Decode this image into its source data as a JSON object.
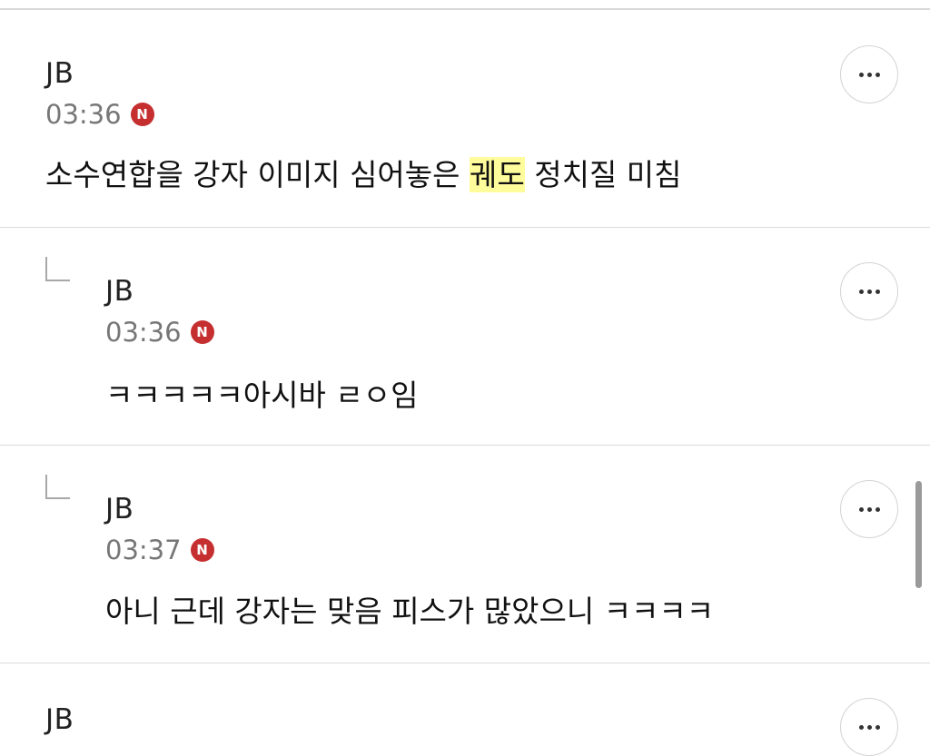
{
  "comments": [
    {
      "author": "JB",
      "time": "03:36",
      "badge": "N",
      "text_before": "소수연합을 강자 이미지 심어놓은 ",
      "text_highlight": "궤도",
      "text_after": " 정치질 미침",
      "reply": false
    },
    {
      "author": "JB",
      "time": "03:36",
      "badge": "N",
      "text": "ㅋㅋㅋㅋㅋ아시바 ㄹㅇ임",
      "reply": true
    },
    {
      "author": "JB",
      "time": "03:37",
      "badge": "N",
      "text": "아니 근데 강자는 맞음 피스가 많았으니 ㅋㅋㅋㅋ",
      "reply": true
    },
    {
      "author": "JB",
      "reply": true
    }
  ],
  "colors": {
    "badge": "#c62f2f",
    "highlight": "#fffc9c",
    "divider": "#dcdcdc"
  },
  "icons": {
    "more": "more-horizontal-icon",
    "reply": "reply-arrow-icon",
    "new": "new-badge-icon"
  }
}
